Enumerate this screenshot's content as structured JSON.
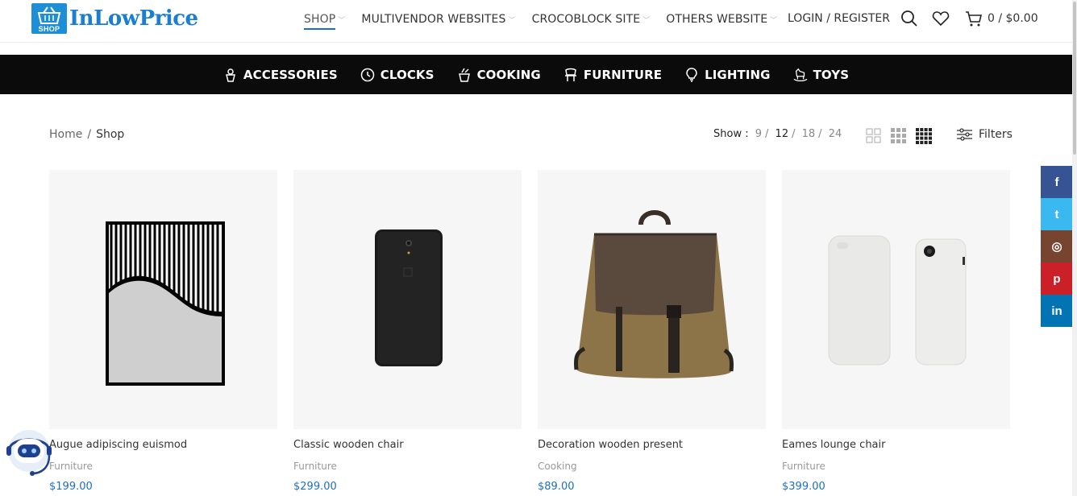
{
  "brand": {
    "name": "InLowPrice",
    "badge": "SHOP",
    "color": "#1e8fd6"
  },
  "nav": {
    "items": [
      {
        "label": "SHOP",
        "active": true
      },
      {
        "label": "MULTIVENDOR WEBSITES"
      },
      {
        "label": "CROCOBLOCK SITE"
      },
      {
        "label": "OTHERS WEBSITE"
      }
    ],
    "login": "LOGIN / REGISTER",
    "cart": "0 / $0.00",
    "icons": [
      "search-icon",
      "heart-icon",
      "cart-icon"
    ]
  },
  "categories": [
    {
      "label": "ACCESSORIES",
      "icon": "accessories-icon"
    },
    {
      "label": "CLOCKS",
      "icon": "clock-icon"
    },
    {
      "label": "COOKING",
      "icon": "cooking-icon"
    },
    {
      "label": "FURNITURE",
      "icon": "chair-icon"
    },
    {
      "label": "LIGHTING",
      "icon": "bulb-icon"
    },
    {
      "label": "TOYS",
      "icon": "rocking-horse-icon"
    }
  ],
  "breadcrumb": {
    "home": "Home",
    "separator": "/",
    "current": "Shop"
  },
  "toolbar": {
    "show_label": "Show :",
    "options": [
      "9",
      "12",
      "18",
      "24"
    ],
    "selected": "12",
    "filters": "Filters"
  },
  "products": [
    {
      "name": "Augue adipiscing euismod",
      "category": "Furniture",
      "price": "$199.00"
    },
    {
      "name": "Classic wooden chair",
      "category": "Furniture",
      "price": "$299.00"
    },
    {
      "name": "Decoration wooden present",
      "category": "Cooking",
      "price": "$89.00"
    },
    {
      "name": "Eames lounge chair",
      "category": "Furniture",
      "price": "$399.00"
    }
  ],
  "social": [
    {
      "name": "facebook",
      "glyph": "f",
      "color": "#365493"
    },
    {
      "name": "twitter",
      "glyph": "t",
      "color": "#3ab9f0"
    },
    {
      "name": "instagram",
      "glyph": "◎",
      "color": "#774430"
    },
    {
      "name": "pinterest",
      "glyph": "p",
      "color": "#cb2027"
    },
    {
      "name": "linkedin",
      "glyph": "in",
      "color": "#0274b3"
    }
  ],
  "colors": {
    "accent": "#1e6fc0",
    "catbar": "#0b0b0b"
  }
}
